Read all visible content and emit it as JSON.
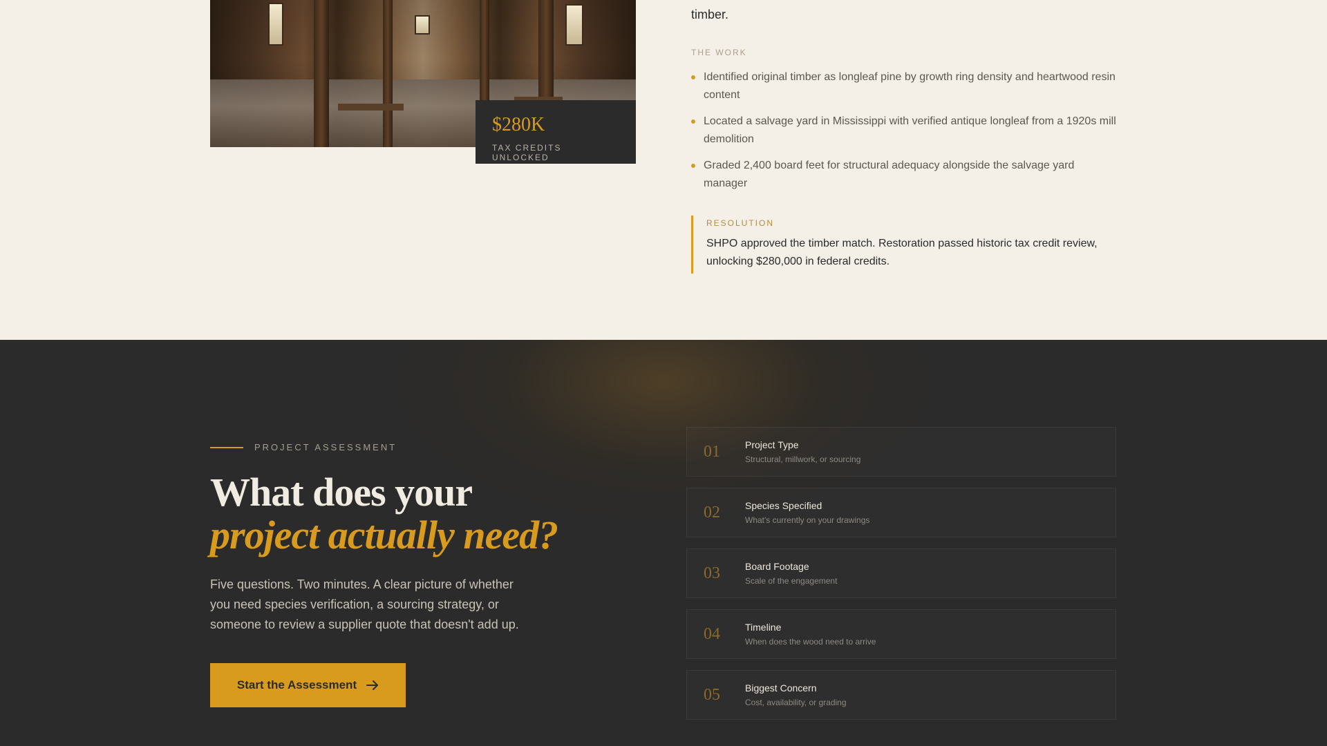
{
  "case_study": {
    "intro_tail": "timber.",
    "stat": {
      "value": "$280K",
      "label": "TAX CREDITS UNLOCKED"
    },
    "work_label": "THE WORK",
    "work_items": [
      "Identified original timber as longleaf pine by growth ring density and heartwood resin content",
      "Located a salvage yard in Mississippi with verified antique longleaf from a 1920s mill demolition",
      "Graded 2,400 board feet for structural adequacy alongside the salvage yard manager"
    ],
    "resolution_label": "RESOLUTION",
    "resolution_text": "SHPO approved the timber match. Restoration passed historic tax credit review, unlocking $280,000 in federal credits."
  },
  "assessment": {
    "eyebrow": "PROJECT ASSESSMENT",
    "heading_line1": "What does your",
    "heading_line2": "project actually need?",
    "lede": "Five questions. Two minutes. A clear picture of whether you need species verification, a sourcing strategy, or someone to review a supplier quote that doesn't add up.",
    "cta_label": "Start the Assessment",
    "cta_icon": "arrow-right-icon",
    "steps": [
      {
        "num": "01",
        "title": "Project Type",
        "sub": "Structural, millwork, or sourcing"
      },
      {
        "num": "02",
        "title": "Species Specified",
        "sub": "What's currently on your drawings"
      },
      {
        "num": "03",
        "title": "Board Footage",
        "sub": "Scale of the engagement"
      },
      {
        "num": "04",
        "title": "Timeline",
        "sub": "When does the wood need to arrive"
      },
      {
        "num": "05",
        "title": "Biggest Concern",
        "sub": "Cost, availability, or grading"
      }
    ]
  },
  "colors": {
    "accent": "#d89b1d",
    "dark_bg": "#2b2b2b",
    "light_bg": "#f4f0e7"
  }
}
